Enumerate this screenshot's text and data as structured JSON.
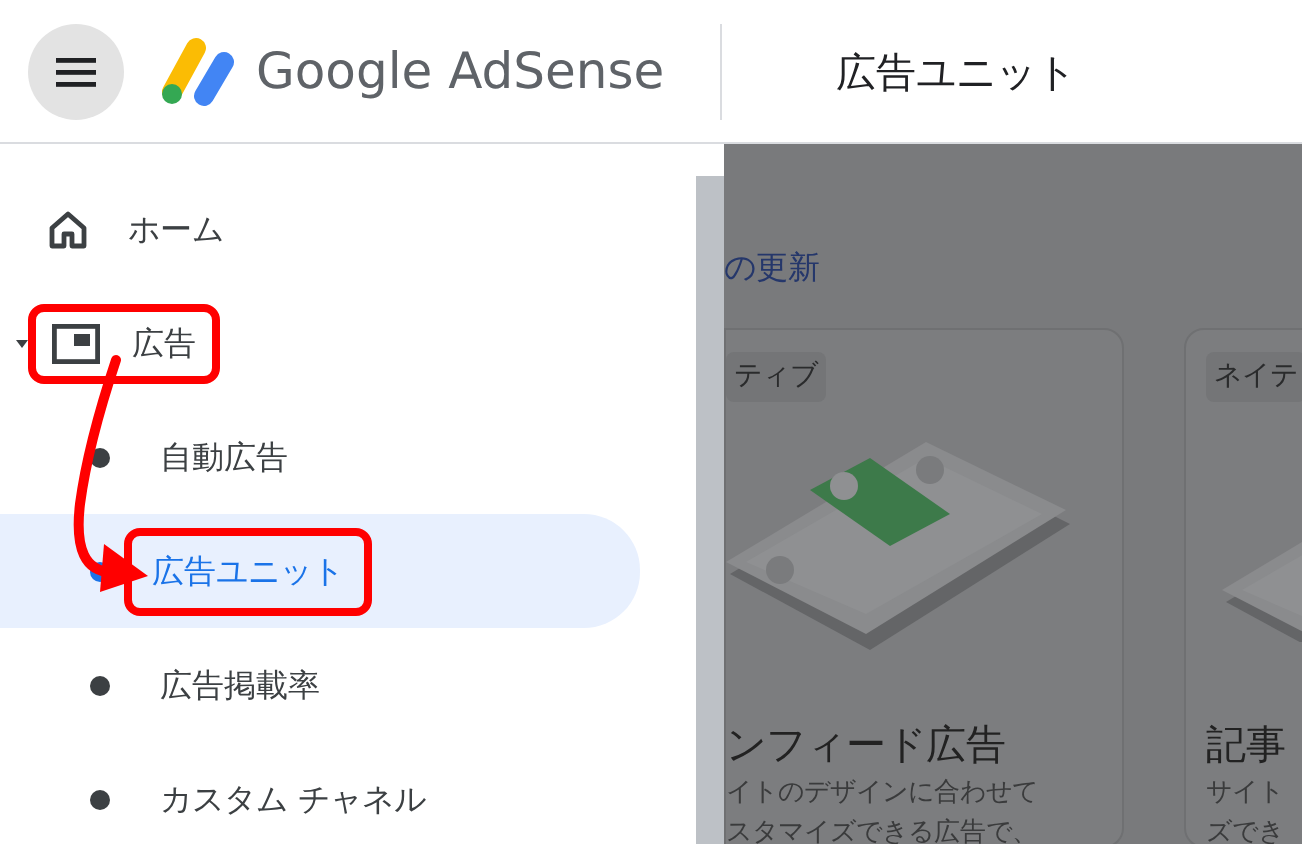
{
  "header": {
    "logo_text": "Google AdSense",
    "page_title": "広告ユニット"
  },
  "sidebar": {
    "items": [
      {
        "kind": "top",
        "label": "ホーム",
        "selected": false,
        "highlighted": false
      },
      {
        "kind": "group",
        "label": "広告",
        "selected": false,
        "expanded": true,
        "highlighted": true,
        "children": [
          {
            "label": "自動広告",
            "selected": false,
            "highlighted": false
          },
          {
            "label": "広告ユニット",
            "selected": true,
            "highlighted": true
          },
          {
            "label": "広告掲載率",
            "selected": false,
            "highlighted": false
          },
          {
            "label": "カスタム チャネル",
            "selected": false,
            "highlighted": false
          }
        ]
      }
    ]
  },
  "annotation_arrow": true,
  "content": {
    "link_text": "の更新",
    "cards": [
      {
        "tag": "ティブ",
        "title": "ンフィード広告",
        "description_lines": [
          "イトのデザインに合わせて",
          "スタマイズできる広告で、"
        ]
      },
      {
        "tag": "ネイテ",
        "title": "記事",
        "description_lines": [
          "サイト",
          "ズでき"
        ]
      }
    ]
  }
}
